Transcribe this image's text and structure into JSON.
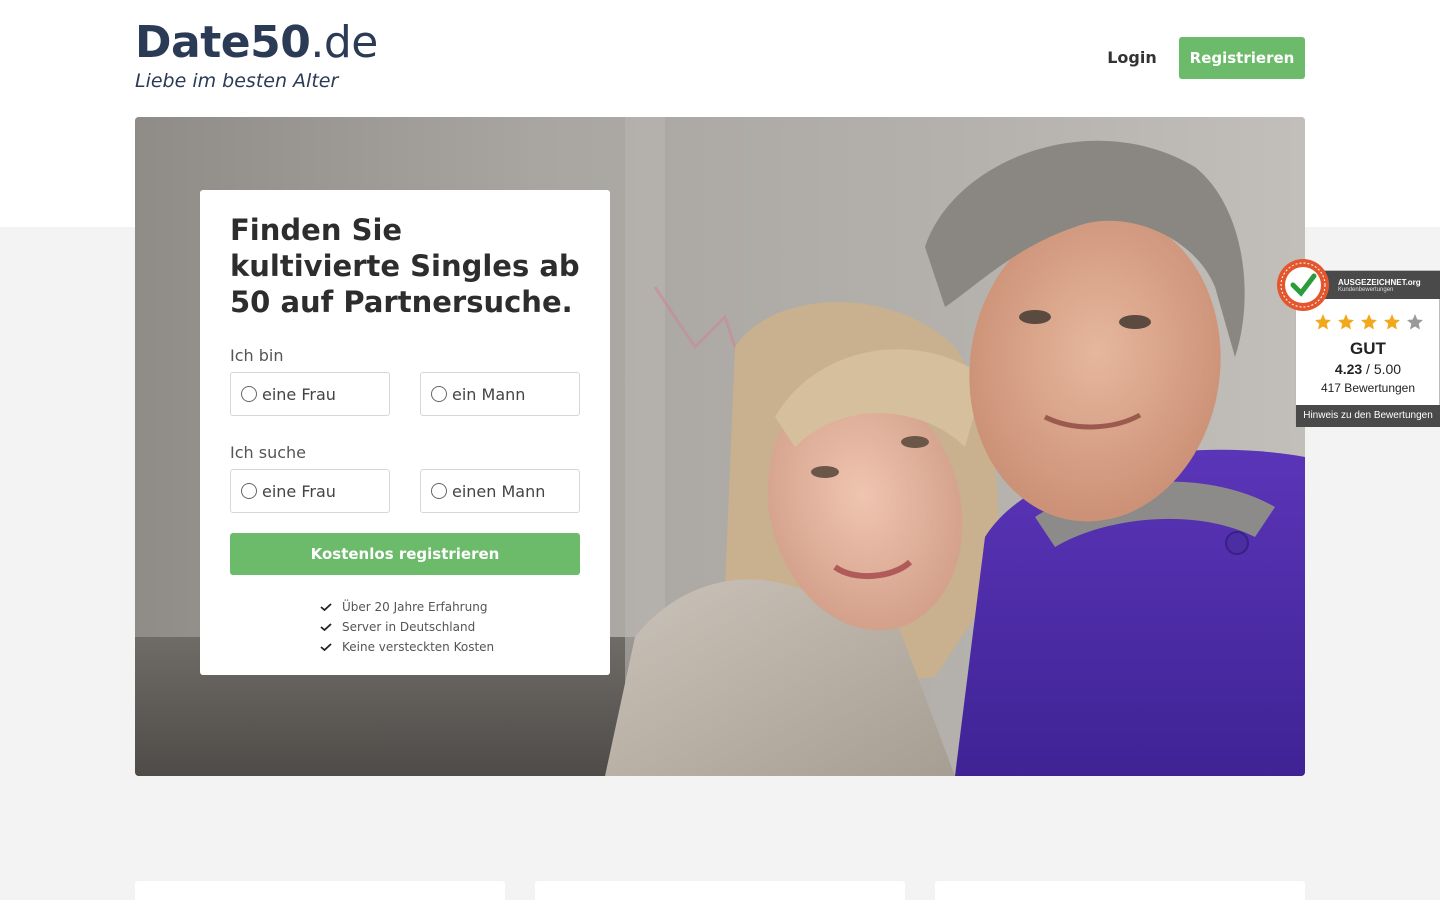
{
  "header": {
    "logo_name": "Date50",
    "logo_tld": ".de",
    "tagline": "Liebe im besten Alter",
    "login_label": "Login",
    "register_label": "Registrieren",
    "accent_color": "#6cbb6a",
    "brand_color": "#2b3a55"
  },
  "form": {
    "title": "Finden Sie kultivierte Singles ab 50 auf Partnersuche.",
    "i_am_label": "Ich bin",
    "i_am_options": [
      "eine Frau",
      "ein Mann"
    ],
    "seeking_label": "Ich suche",
    "seeking_options": [
      "eine Frau",
      "einen Mann"
    ],
    "cta_label": "Kostenlos registrieren",
    "features": [
      "Über 20 Jahre Erfahrung",
      "Server in Deutschland",
      "Keine versteckten Kosten"
    ]
  },
  "badge": {
    "brand": "AUSGEZEICHNET.org",
    "subtitle": "Kundenbewertungen",
    "seal_text": "AUSGEZEICHNET.ORG",
    "stars": 4.23,
    "grade": "GUT",
    "score": "4.23",
    "score_max": "/ 5.00",
    "reviews": "417 Bewertungen",
    "footer_link": "Hinweis zu den Bewertungen"
  }
}
